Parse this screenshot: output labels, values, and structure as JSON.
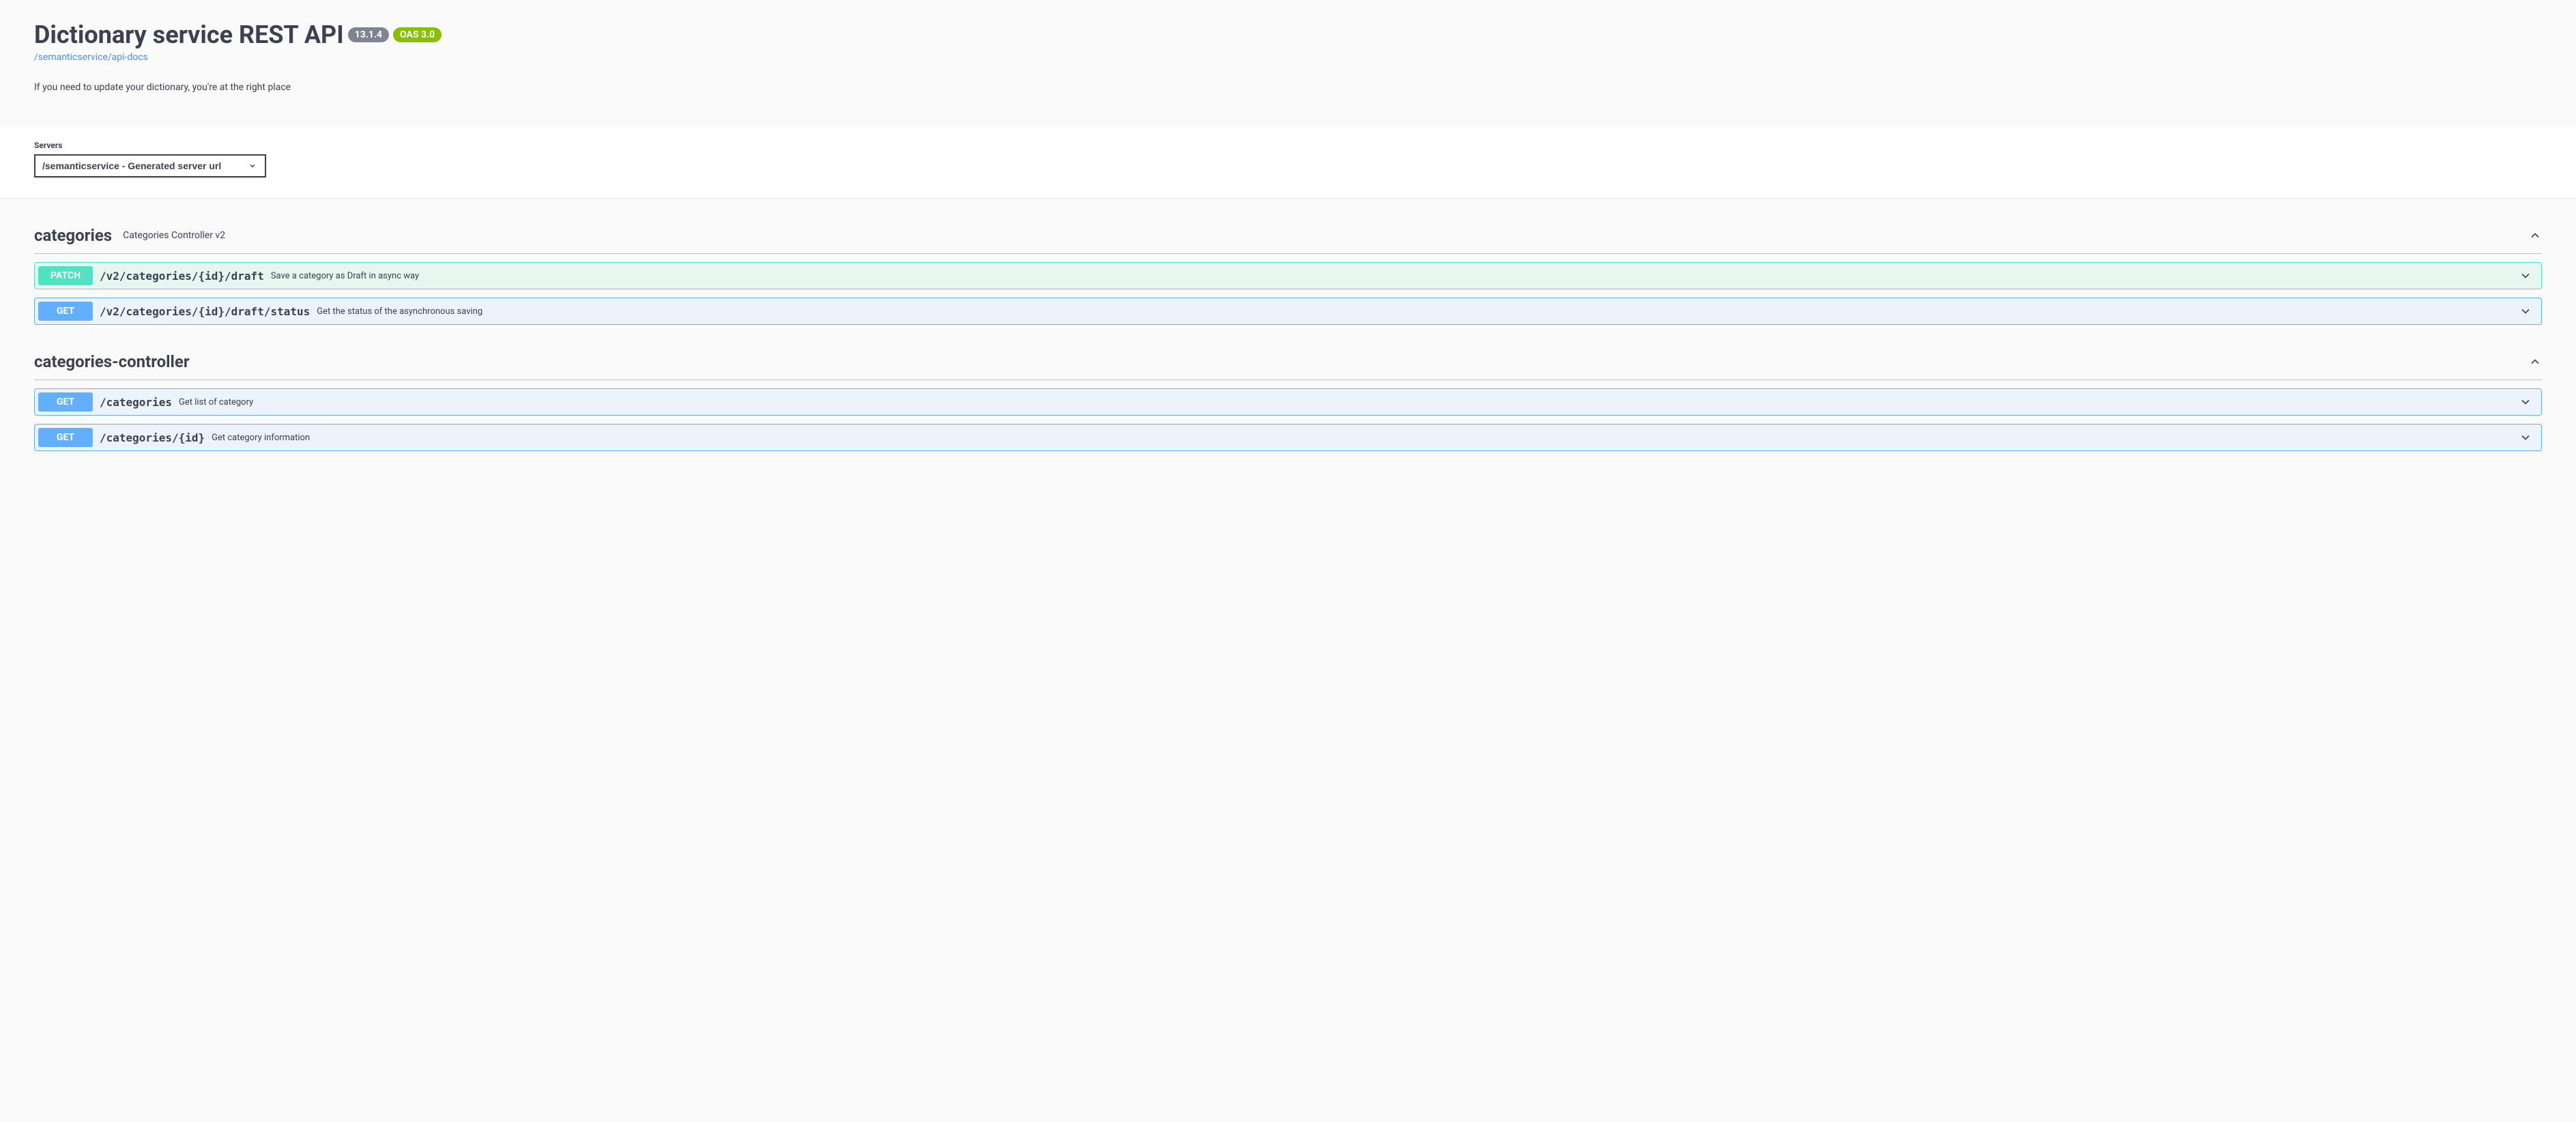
{
  "header": {
    "title": "Dictionary service REST API",
    "version": "13.1.4",
    "oas": "OAS 3.0",
    "docs_link": "/semanticservice/api-docs",
    "description": "If you need to update your dictionary, you're at the right place"
  },
  "servers": {
    "label": "Servers",
    "selected": "/semanticservice - Generated server url"
  },
  "tags": [
    {
      "name": "categories",
      "description": "Categories Controller v2",
      "operations": [
        {
          "method": "PATCH",
          "path": "/v2/categories/{id}/draft",
          "summary": "Save a category as Draft in async way"
        },
        {
          "method": "GET",
          "path": "/v2/categories/{id}/draft/status",
          "summary": "Get the status of the asynchronous saving"
        }
      ]
    },
    {
      "name": "categories-controller",
      "description": "",
      "operations": [
        {
          "method": "GET",
          "path": "/categories",
          "summary": "Get list of category"
        },
        {
          "method": "GET",
          "path": "/categories/{id}",
          "summary": "Get category information"
        }
      ]
    }
  ]
}
